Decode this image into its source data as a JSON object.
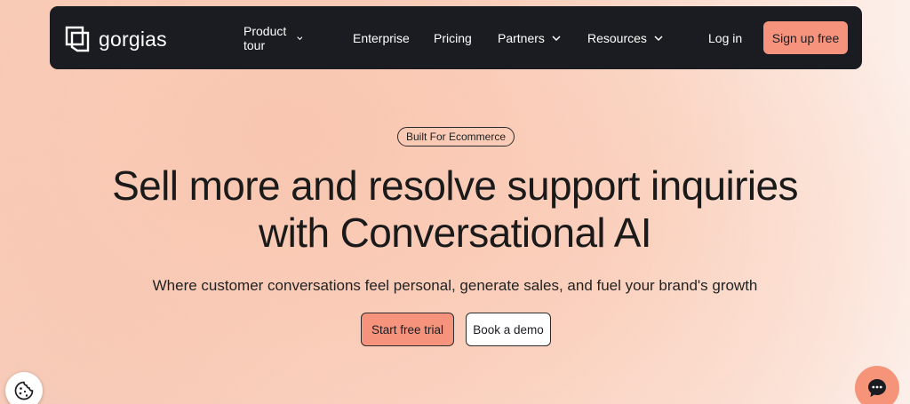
{
  "brand": {
    "name": "gorgias",
    "logo_icon": "gorgias-logo-icon"
  },
  "nav": {
    "items": [
      {
        "label": "Product tour",
        "has_dropdown": true
      },
      {
        "label": "Enterprise",
        "has_dropdown": false
      },
      {
        "label": "Pricing",
        "has_dropdown": false
      },
      {
        "label": "Partners",
        "has_dropdown": true
      },
      {
        "label": "Resources",
        "has_dropdown": true
      }
    ],
    "login_label": "Log in",
    "signup_label": "Sign up free"
  },
  "hero": {
    "badge": "Built For Ecommerce",
    "headline_line1": "Sell more and resolve support inquiries",
    "headline_line2": "with Conversational AI",
    "subheadline": "Where customer conversations feel personal, generate sales, and fuel your brand's growth",
    "primary_cta": "Start free trial",
    "secondary_cta": "Book a demo"
  },
  "widgets": {
    "cookie_icon": "cookie-icon",
    "chat_icon": "chat-icon"
  },
  "colors": {
    "nav_bg": "#1b1c21",
    "accent": "#f5937c",
    "background": "#f9cdb8"
  }
}
